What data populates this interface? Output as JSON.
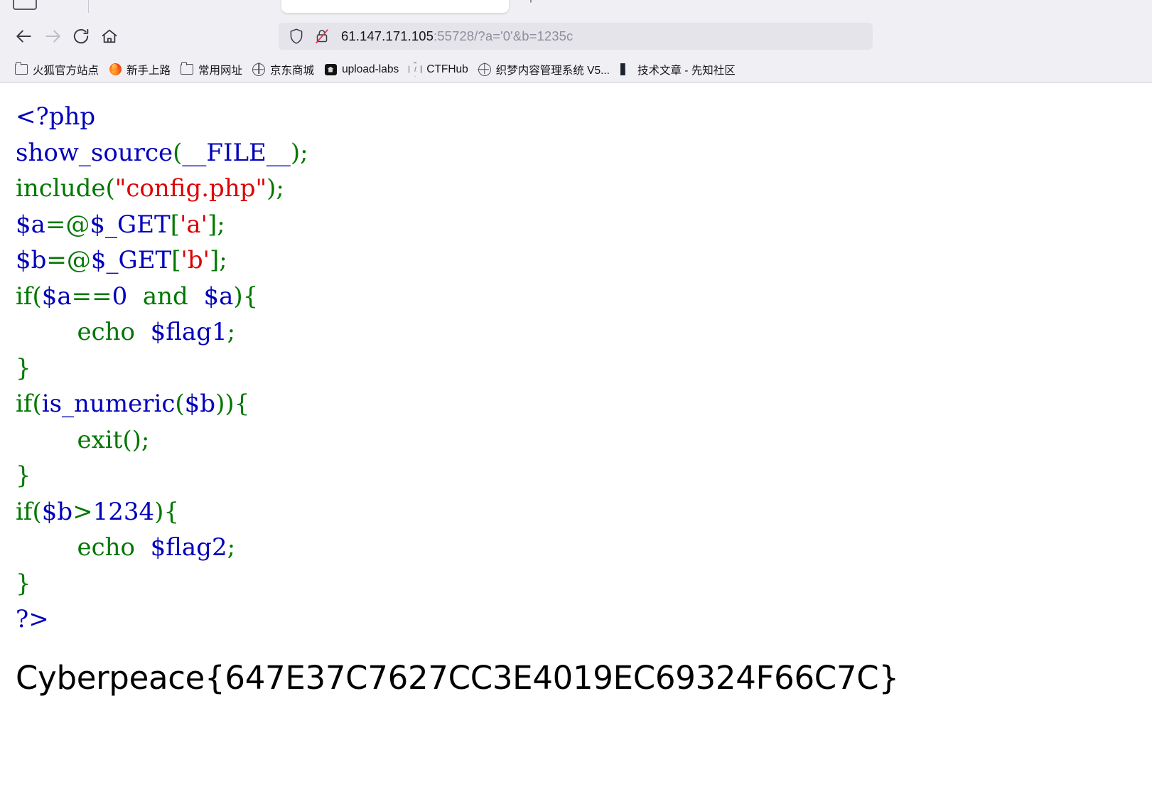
{
  "browser": {
    "tabstrip": {
      "new_tab_label": "+",
      "tab_title": ""
    },
    "nav": {
      "back_label": "Back",
      "forward_label": "Forward",
      "reload_label": "Reload",
      "home_label": "Home"
    },
    "urlbar": {
      "host": "61.147.171.105",
      "path": ":55728/?a='0'&b=1235c",
      "full_url": "61.147.171.105:55728/?a='0'&b=1235c",
      "shield_icon": "shield-icon",
      "lock_icon": "lock-slash-icon"
    },
    "bookmarks": [
      {
        "label": "火狐官方站点",
        "icon": "folder-icon"
      },
      {
        "label": "新手上路",
        "icon": "firefox-icon"
      },
      {
        "label": "常用网址",
        "icon": "folder-icon"
      },
      {
        "label": "京东商城",
        "icon": "globe-icon"
      },
      {
        "label": "upload-labs",
        "icon": "upload-labs-icon"
      },
      {
        "label": "CTFHub",
        "icon": "ctfhub-icon"
      },
      {
        "label": "织梦内容管理系统 V5...",
        "icon": "globe-icon"
      },
      {
        "label": "技术文章 - 先知社区",
        "icon": "xianzhi-icon"
      }
    ]
  },
  "page": {
    "source_lines": [
      [
        {
          "t": "<?php",
          "c": "var"
        }
      ],
      [
        {
          "t": "show_source",
          "c": "var"
        },
        {
          "t": "(",
          "c": "kw"
        },
        {
          "t": "__FILE__",
          "c": "var"
        },
        {
          "t": ")",
          "c": "kw"
        },
        {
          "t": ";",
          "c": "kw"
        }
      ],
      [
        {
          "t": "include",
          "c": "kw"
        },
        {
          "t": "(",
          "c": "kw"
        },
        {
          "t": "\"config.php\"",
          "c": "str"
        },
        {
          "t": ")",
          "c": "kw"
        },
        {
          "t": ";",
          "c": "kw"
        }
      ],
      [
        {
          "t": "$a",
          "c": "var"
        },
        {
          "t": "=@",
          "c": "kw"
        },
        {
          "t": "$_GET",
          "c": "var"
        },
        {
          "t": "[",
          "c": "kw"
        },
        {
          "t": "'a'",
          "c": "str"
        },
        {
          "t": "]",
          "c": "kw"
        },
        {
          "t": ";",
          "c": "kw"
        }
      ],
      [
        {
          "t": "$b",
          "c": "var"
        },
        {
          "t": "=@",
          "c": "kw"
        },
        {
          "t": "$_GET",
          "c": "var"
        },
        {
          "t": "[",
          "c": "kw"
        },
        {
          "t": "'b'",
          "c": "str"
        },
        {
          "t": "]",
          "c": "kw"
        },
        {
          "t": ";",
          "c": "kw"
        }
      ],
      [
        {
          "t": "if",
          "c": "kw"
        },
        {
          "t": "(",
          "c": "kw"
        },
        {
          "t": "$a",
          "c": "var"
        },
        {
          "t": "==",
          "c": "kw"
        },
        {
          "t": "0",
          "c": "var"
        },
        {
          "t": "  and  ",
          "c": "kw"
        },
        {
          "t": "$a",
          "c": "var"
        },
        {
          "t": ")",
          "c": "kw"
        },
        {
          "t": "{",
          "c": "kw"
        }
      ],
      [
        {
          "t": "        ",
          "c": "kw"
        },
        {
          "t": "echo",
          "c": "kw"
        },
        {
          "t": "  ",
          "c": "kw"
        },
        {
          "t": "$flag1",
          "c": "var"
        },
        {
          "t": ";",
          "c": "kw"
        }
      ],
      [
        {
          "t": "}",
          "c": "kw"
        }
      ],
      [
        {
          "t": "if",
          "c": "kw"
        },
        {
          "t": "(",
          "c": "kw"
        },
        {
          "t": "is_numeric",
          "c": "var"
        },
        {
          "t": "(",
          "c": "kw"
        },
        {
          "t": "$b",
          "c": "var"
        },
        {
          "t": ")",
          "c": "kw"
        },
        {
          "t": ")",
          "c": "kw"
        },
        {
          "t": "{",
          "c": "kw"
        }
      ],
      [
        {
          "t": "        ",
          "c": "kw"
        },
        {
          "t": "exit",
          "c": "kw"
        },
        {
          "t": "()",
          "c": "kw"
        },
        {
          "t": ";",
          "c": "kw"
        }
      ],
      [
        {
          "t": "}",
          "c": "kw"
        }
      ],
      [
        {
          "t": "if",
          "c": "kw"
        },
        {
          "t": "(",
          "c": "kw"
        },
        {
          "t": "$b",
          "c": "var"
        },
        {
          "t": ">",
          "c": "kw"
        },
        {
          "t": "1234",
          "c": "var"
        },
        {
          "t": ")",
          "c": "kw"
        },
        {
          "t": "{",
          "c": "kw"
        }
      ],
      [
        {
          "t": "        ",
          "c": "kw"
        },
        {
          "t": "echo",
          "c": "kw"
        },
        {
          "t": "  ",
          "c": "kw"
        },
        {
          "t": "$flag2",
          "c": "var"
        },
        {
          "t": ";",
          "c": "kw"
        }
      ],
      [
        {
          "t": "}",
          "c": "kw"
        }
      ],
      [
        {
          "t": "?>",
          "c": "var"
        }
      ]
    ],
    "flag": "Cyberpeace{647E37C7627CC3E4019EC69324F66C7C}"
  },
  "colors": {
    "php_keyword": "#007700",
    "php_default": "#0000bb",
    "php_string": "#dd0000",
    "chrome_bg": "#f0f0f4",
    "urlbar_bg": "#e4e4ea",
    "text": "#15141a",
    "text_dim": "#8f8f9d"
  }
}
